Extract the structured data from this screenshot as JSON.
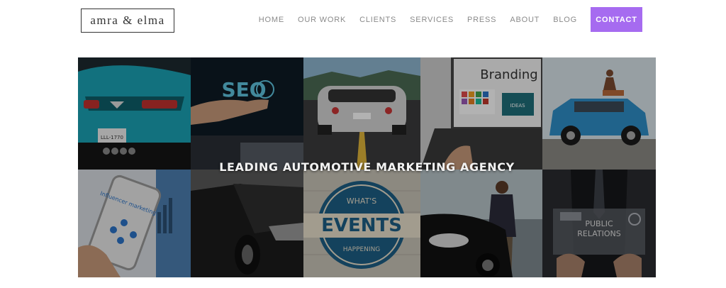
{
  "brand": {
    "logo_text": "amra & elma"
  },
  "nav": {
    "items": [
      {
        "label": "HOME"
      },
      {
        "label": "OUR WORK"
      },
      {
        "label": "CLIENTS"
      },
      {
        "label": "SERVICES"
      },
      {
        "label": "PRESS"
      },
      {
        "label": "ABOUT"
      },
      {
        "label": "BLOG"
      }
    ],
    "contact_label": "CONTACT"
  },
  "hero": {
    "headline": "LEADING AUTOMOTIVE MARKETING AGENCY",
    "tiles": [
      {
        "name": "corvette-rear-photo",
        "plate": "LLL-1770"
      },
      {
        "name": "seo-hand-photo",
        "label": "SEO"
      },
      {
        "name": "gtr-road-photo"
      },
      {
        "name": "branding-laptop-photo",
        "label": "Branding",
        "badge": "IDEAS"
      },
      {
        "name": "mini-cooper-photo"
      },
      {
        "name": "influencer-phone-photo",
        "label": "Influencer marketing"
      },
      {
        "name": "black-sedans-photo"
      },
      {
        "name": "events-sign-photo",
        "top": "WHAT'S",
        "label": "EVENTS",
        "bottom": "HAPPENING"
      },
      {
        "name": "man-with-car-photo"
      },
      {
        "name": "public-relations-photo",
        "label": "PUBLIC RELATIONS",
        "line1": "PUBLIC",
        "line2": "RELATIONS"
      }
    ]
  },
  "colors": {
    "accent": "#a66bf0",
    "nav_text": "#8a8a8a",
    "logo_border": "#333333"
  }
}
